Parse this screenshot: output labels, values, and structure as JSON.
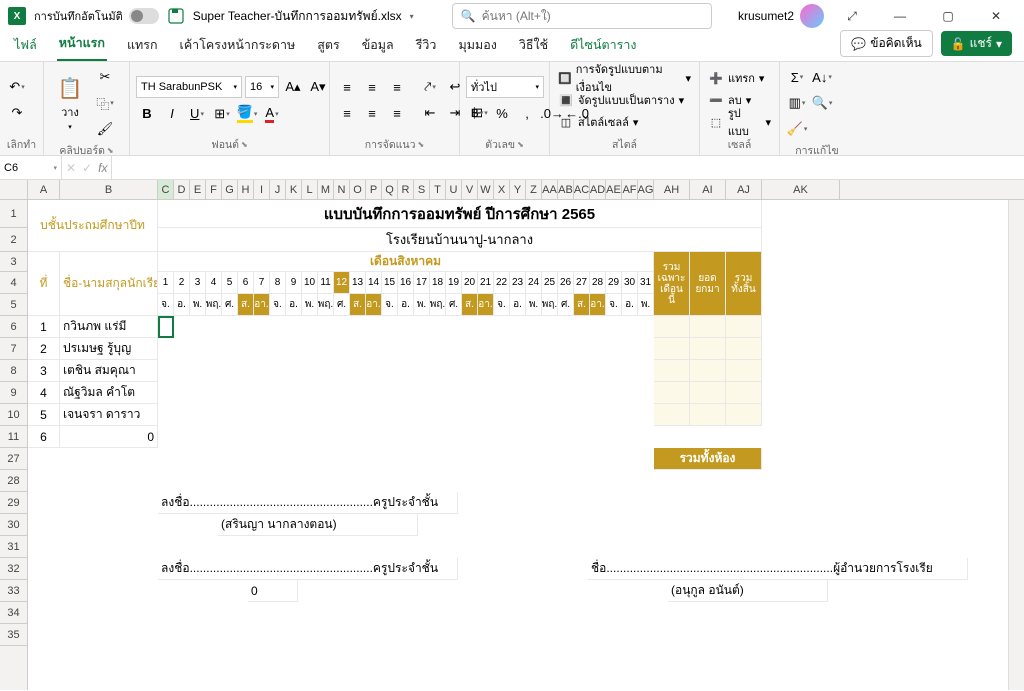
{
  "titlebar": {
    "autosave_label": "การบันทึกอัตโนมัติ",
    "filename": "Super Teacher-บันทึกการออมทรัพย์.xlsx",
    "search_placeholder": "ค้นหา (Alt+ใ)",
    "username": "krusumet2"
  },
  "tabs": {
    "file": "ไฟล์",
    "home": "หน้าแรก",
    "insert": "แทรก",
    "layout": "เค้าโครงหน้ากระดาษ",
    "formulas": "สูตร",
    "data": "ข้อมูล",
    "review": "รีวิว",
    "view": "มุมมอง",
    "help": "วิธีใช้",
    "design": "ดีไซน์ตาราง",
    "comments": "ข้อคิดเห็น",
    "share": "แชร์"
  },
  "ribbon": {
    "undo": "เลิกทำ",
    "clipboard": "คลิปบอร์ด",
    "paste": "วาง",
    "font_group": "ฟอนต์",
    "font_name": "TH SarabunPSK",
    "font_size": "16",
    "align": "การจัดแนว",
    "number": "ตัวเลข",
    "number_format": "ทั่วไป",
    "styles": "สไตล์",
    "cond_format": "การจัดรูปแบบตามเงื่อนไข",
    "table_format": "จัดรูปแบบเป็นตาราง",
    "cell_styles": "สไตล์เซลล์",
    "cells": "เซลล์",
    "insert_cell": "แทรก",
    "delete_cell": "ลบ",
    "format_cell": "รูปแบบ",
    "editing": "การแก้ไข"
  },
  "namebox": "C6",
  "sheet": {
    "title": "แบบบันทึกการออมทรัพย์ ปีการศึกษา 2565",
    "school": "โรงเรียนบ้านนาปู-นากลาง",
    "month": "เดือนสิงหาคม",
    "grade_partial": "บชั้นประถมศึกษาปีท",
    "col_num": "ที่",
    "col_name": "ชื่อ-นามสกุลนักเรียน",
    "days": [
      "1",
      "2",
      "3",
      "4",
      "5",
      "6",
      "7",
      "8",
      "9",
      "10",
      "11",
      "12",
      "13",
      "14",
      "15",
      "16",
      "17",
      "18",
      "19",
      "20",
      "21",
      "22",
      "23",
      "24",
      "25",
      "26",
      "27",
      "28",
      "29",
      "30",
      "31"
    ],
    "dow": [
      "จ.",
      "อ.",
      "พ.",
      "พฤ.",
      "ศ.",
      "ส.",
      "อา.",
      "จ.",
      "อ.",
      "พ.",
      "พฤ.",
      "ศ.",
      "ส.",
      "อา.",
      "จ.",
      "อ.",
      "พ.",
      "พฤ.",
      "ศ.",
      "ส.",
      "อา.",
      "จ.",
      "อ.",
      "พ.",
      "พฤ.",
      "ศ.",
      "ส.",
      "อา.",
      "จ.",
      "อ.",
      "พ."
    ],
    "sum1": "รวมเฉพาะเดือนนี้",
    "sum2": "ยอดยกมา",
    "sum3": "รวมทั้งสิ้น",
    "students": [
      {
        "n": "1",
        "name": "กวินภพ แร่มี"
      },
      {
        "n": "2",
        "name": "ปรเมษฐ รู้บุญ"
      },
      {
        "n": "3",
        "name": "เตชิน สมคุณา"
      },
      {
        "n": "4",
        "name": "ณัฐวิมล คำโต"
      },
      {
        "n": "5",
        "name": "เจนจรา ดาราว"
      }
    ],
    "row11_a": "6",
    "row11_b": "0",
    "total_room": "รวมทั้งห้อง",
    "sign": "ลงชื่อ",
    "teacher_role": "ครูประจำชั้น",
    "teacher_name": "(สรินญา นากลางตอน)",
    "sign2_name": "ชื่อ",
    "principal_role": "ผู้อำนวยการโรงเรีย",
    "principal_name": "(อนุกูล อนันต์)",
    "zero": "0"
  },
  "columns": {
    "letters": [
      "A",
      "B",
      "C",
      "D",
      "E",
      "F",
      "G",
      "H",
      "I",
      "J",
      "K",
      "L",
      "M",
      "N",
      "O",
      "P",
      "Q",
      "R",
      "S",
      "T",
      "U",
      "V",
      "W",
      "X",
      "Y",
      "Z",
      "AA",
      "AB",
      "AC",
      "AD",
      "AE",
      "AF",
      "AG",
      "AH",
      "AI",
      "AJ",
      "AK"
    ],
    "widths": [
      32,
      98,
      16,
      16,
      16,
      16,
      16,
      16,
      16,
      16,
      16,
      16,
      16,
      16,
      16,
      16,
      16,
      16,
      16,
      16,
      16,
      16,
      16,
      16,
      16,
      16,
      16,
      16,
      16,
      16,
      16,
      16,
      16,
      36,
      36,
      36,
      78
    ]
  }
}
